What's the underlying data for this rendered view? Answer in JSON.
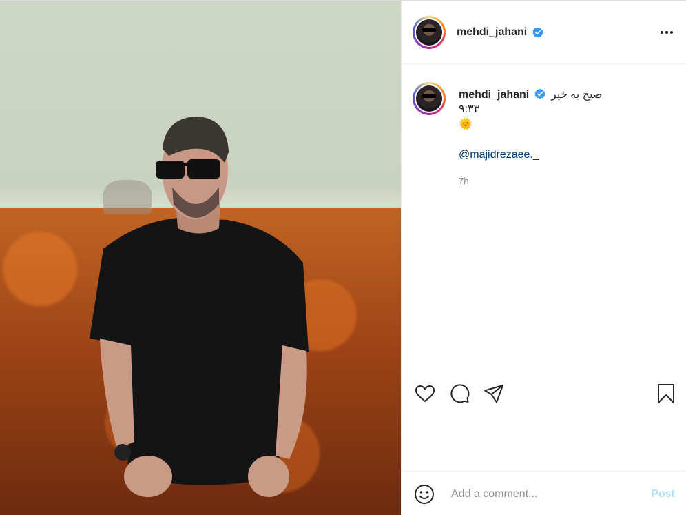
{
  "header": {
    "username": "mehdi_jahani",
    "verified": true
  },
  "caption": {
    "username": "mehdi_jahani",
    "text_line1": "صبح به خیر",
    "text_line2": "۹:۳۳",
    "emoji": "🌞",
    "mention": "@majidrezaee._",
    "time": "7h"
  },
  "actions": {
    "like_icon": "heart-icon",
    "comment_icon": "comment-icon",
    "share_icon": "paper-plane-icon",
    "save_icon": "bookmark-icon"
  },
  "comment": {
    "placeholder": "Add a comment...",
    "post_label": "Post"
  },
  "colors": {
    "verified_blue": "#3897f0",
    "mention": "#00376b",
    "post_button": "#b2dffc",
    "muted": "#8e8e8e"
  }
}
